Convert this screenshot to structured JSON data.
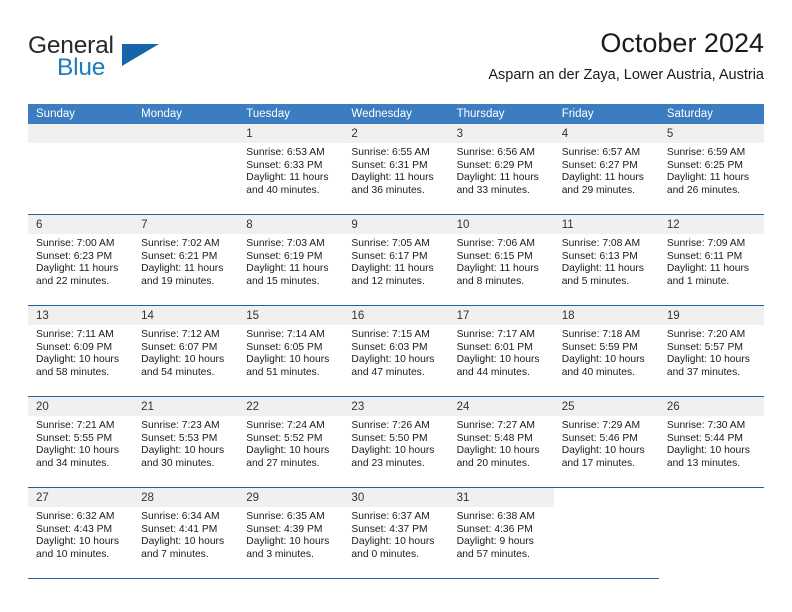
{
  "brand": {
    "name_top": "General",
    "name_bottom": "Blue",
    "triangle_icon": "brand-triangle-icon",
    "color_dark": "#25292d",
    "color_blue": "#1f7bc1"
  },
  "header": {
    "title": "October 2024",
    "subtitle": "Asparn an der Zaya, Lower Austria, Austria"
  },
  "theme": {
    "header_blue": "#3b7dc0",
    "rule_blue": "#1665ab",
    "daynum_band": "#f0f0f0"
  },
  "calendar": {
    "weekdays": [
      "Sunday",
      "Monday",
      "Tuesday",
      "Wednesday",
      "Thursday",
      "Friday",
      "Saturday"
    ],
    "weeks": [
      [
        {
          "day": "",
          "sunrise": "",
          "sunset": "",
          "daylight_1": "",
          "daylight_2": ""
        },
        {
          "day": "",
          "sunrise": "",
          "sunset": "",
          "daylight_1": "",
          "daylight_2": ""
        },
        {
          "day": "1",
          "sunrise": "Sunrise: 6:53 AM",
          "sunset": "Sunset: 6:33 PM",
          "daylight_1": "Daylight: 11 hours",
          "daylight_2": "and 40 minutes."
        },
        {
          "day": "2",
          "sunrise": "Sunrise: 6:55 AM",
          "sunset": "Sunset: 6:31 PM",
          "daylight_1": "Daylight: 11 hours",
          "daylight_2": "and 36 minutes."
        },
        {
          "day": "3",
          "sunrise": "Sunrise: 6:56 AM",
          "sunset": "Sunset: 6:29 PM",
          "daylight_1": "Daylight: 11 hours",
          "daylight_2": "and 33 minutes."
        },
        {
          "day": "4",
          "sunrise": "Sunrise: 6:57 AM",
          "sunset": "Sunset: 6:27 PM",
          "daylight_1": "Daylight: 11 hours",
          "daylight_2": "and 29 minutes."
        },
        {
          "day": "5",
          "sunrise": "Sunrise: 6:59 AM",
          "sunset": "Sunset: 6:25 PM",
          "daylight_1": "Daylight: 11 hours",
          "daylight_2": "and 26 minutes."
        }
      ],
      [
        {
          "day": "6",
          "sunrise": "Sunrise: 7:00 AM",
          "sunset": "Sunset: 6:23 PM",
          "daylight_1": "Daylight: 11 hours",
          "daylight_2": "and 22 minutes."
        },
        {
          "day": "7",
          "sunrise": "Sunrise: 7:02 AM",
          "sunset": "Sunset: 6:21 PM",
          "daylight_1": "Daylight: 11 hours",
          "daylight_2": "and 19 minutes."
        },
        {
          "day": "8",
          "sunrise": "Sunrise: 7:03 AM",
          "sunset": "Sunset: 6:19 PM",
          "daylight_1": "Daylight: 11 hours",
          "daylight_2": "and 15 minutes."
        },
        {
          "day": "9",
          "sunrise": "Sunrise: 7:05 AM",
          "sunset": "Sunset: 6:17 PM",
          "daylight_1": "Daylight: 11 hours",
          "daylight_2": "and 12 minutes."
        },
        {
          "day": "10",
          "sunrise": "Sunrise: 7:06 AM",
          "sunset": "Sunset: 6:15 PM",
          "daylight_1": "Daylight: 11 hours",
          "daylight_2": "and 8 minutes."
        },
        {
          "day": "11",
          "sunrise": "Sunrise: 7:08 AM",
          "sunset": "Sunset: 6:13 PM",
          "daylight_1": "Daylight: 11 hours",
          "daylight_2": "and 5 minutes."
        },
        {
          "day": "12",
          "sunrise": "Sunrise: 7:09 AM",
          "sunset": "Sunset: 6:11 PM",
          "daylight_1": "Daylight: 11 hours",
          "daylight_2": "and 1 minute."
        }
      ],
      [
        {
          "day": "13",
          "sunrise": "Sunrise: 7:11 AM",
          "sunset": "Sunset: 6:09 PM",
          "daylight_1": "Daylight: 10 hours",
          "daylight_2": "and 58 minutes."
        },
        {
          "day": "14",
          "sunrise": "Sunrise: 7:12 AM",
          "sunset": "Sunset: 6:07 PM",
          "daylight_1": "Daylight: 10 hours",
          "daylight_2": "and 54 minutes."
        },
        {
          "day": "15",
          "sunrise": "Sunrise: 7:14 AM",
          "sunset": "Sunset: 6:05 PM",
          "daylight_1": "Daylight: 10 hours",
          "daylight_2": "and 51 minutes."
        },
        {
          "day": "16",
          "sunrise": "Sunrise: 7:15 AM",
          "sunset": "Sunset: 6:03 PM",
          "daylight_1": "Daylight: 10 hours",
          "daylight_2": "and 47 minutes."
        },
        {
          "day": "17",
          "sunrise": "Sunrise: 7:17 AM",
          "sunset": "Sunset: 6:01 PM",
          "daylight_1": "Daylight: 10 hours",
          "daylight_2": "and 44 minutes."
        },
        {
          "day": "18",
          "sunrise": "Sunrise: 7:18 AM",
          "sunset": "Sunset: 5:59 PM",
          "daylight_1": "Daylight: 10 hours",
          "daylight_2": "and 40 minutes."
        },
        {
          "day": "19",
          "sunrise": "Sunrise: 7:20 AM",
          "sunset": "Sunset: 5:57 PM",
          "daylight_1": "Daylight: 10 hours",
          "daylight_2": "and 37 minutes."
        }
      ],
      [
        {
          "day": "20",
          "sunrise": "Sunrise: 7:21 AM",
          "sunset": "Sunset: 5:55 PM",
          "daylight_1": "Daylight: 10 hours",
          "daylight_2": "and 34 minutes."
        },
        {
          "day": "21",
          "sunrise": "Sunrise: 7:23 AM",
          "sunset": "Sunset: 5:53 PM",
          "daylight_1": "Daylight: 10 hours",
          "daylight_2": "and 30 minutes."
        },
        {
          "day": "22",
          "sunrise": "Sunrise: 7:24 AM",
          "sunset": "Sunset: 5:52 PM",
          "daylight_1": "Daylight: 10 hours",
          "daylight_2": "and 27 minutes."
        },
        {
          "day": "23",
          "sunrise": "Sunrise: 7:26 AM",
          "sunset": "Sunset: 5:50 PM",
          "daylight_1": "Daylight: 10 hours",
          "daylight_2": "and 23 minutes."
        },
        {
          "day": "24",
          "sunrise": "Sunrise: 7:27 AM",
          "sunset": "Sunset: 5:48 PM",
          "daylight_1": "Daylight: 10 hours",
          "daylight_2": "and 20 minutes."
        },
        {
          "day": "25",
          "sunrise": "Sunrise: 7:29 AM",
          "sunset": "Sunset: 5:46 PM",
          "daylight_1": "Daylight: 10 hours",
          "daylight_2": "and 17 minutes."
        },
        {
          "day": "26",
          "sunrise": "Sunrise: 7:30 AM",
          "sunset": "Sunset: 5:44 PM",
          "daylight_1": "Daylight: 10 hours",
          "daylight_2": "and 13 minutes."
        }
      ],
      [
        {
          "day": "27",
          "sunrise": "Sunrise: 6:32 AM",
          "sunset": "Sunset: 4:43 PM",
          "daylight_1": "Daylight: 10 hours",
          "daylight_2": "and 10 minutes."
        },
        {
          "day": "28",
          "sunrise": "Sunrise: 6:34 AM",
          "sunset": "Sunset: 4:41 PM",
          "daylight_1": "Daylight: 10 hours",
          "daylight_2": "and 7 minutes."
        },
        {
          "day": "29",
          "sunrise": "Sunrise: 6:35 AM",
          "sunset": "Sunset: 4:39 PM",
          "daylight_1": "Daylight: 10 hours",
          "daylight_2": "and 3 minutes."
        },
        {
          "day": "30",
          "sunrise": "Sunrise: 6:37 AM",
          "sunset": "Sunset: 4:37 PM",
          "daylight_1": "Daylight: 10 hours",
          "daylight_2": "and 0 minutes."
        },
        {
          "day": "31",
          "sunrise": "Sunrise: 6:38 AM",
          "sunset": "Sunset: 4:36 PM",
          "daylight_1": "Daylight: 9 hours",
          "daylight_2": "and 57 minutes."
        },
        {
          "day": "",
          "sunrise": "",
          "sunset": "",
          "daylight_1": "",
          "daylight_2": ""
        },
        {
          "day": "",
          "sunrise": "",
          "sunset": "",
          "daylight_1": "",
          "daylight_2": ""
        }
      ]
    ]
  }
}
